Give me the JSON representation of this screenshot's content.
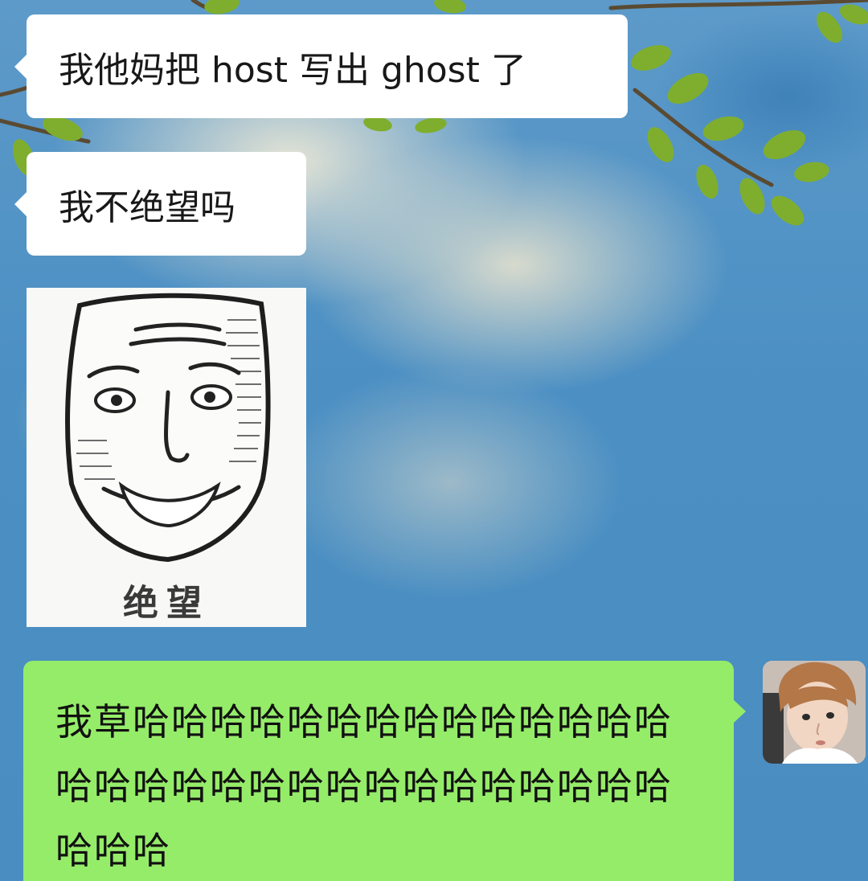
{
  "messages": [
    {
      "sender": "other",
      "type": "text",
      "text": "我他妈把 host 写出 ghost 了"
    },
    {
      "sender": "other",
      "type": "text",
      "text": "我不绝望吗"
    },
    {
      "sender": "other",
      "type": "sticker",
      "caption": "绝望",
      "icon": "despair-face-sticker"
    },
    {
      "sender": "me",
      "type": "text",
      "text": "我草哈哈哈哈哈哈哈哈哈哈哈哈哈哈哈哈哈哈哈哈哈哈哈哈哈哈哈哈哈哈哈哈哈"
    }
  ],
  "colors": {
    "bubble_other": "#ffffff",
    "bubble_me": "#95ec69",
    "sky": "#4b8fc3"
  }
}
